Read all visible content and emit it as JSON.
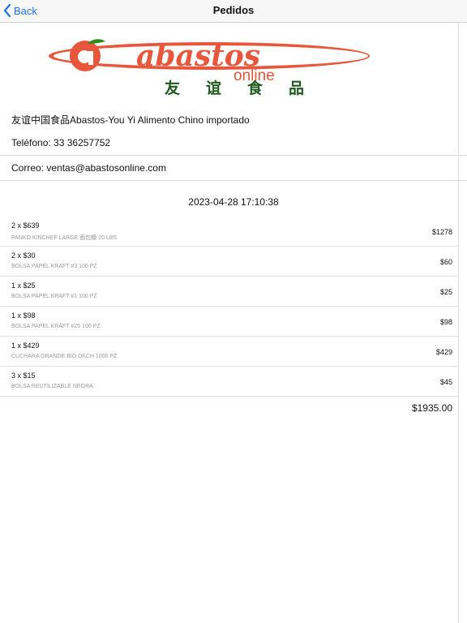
{
  "navbar": {
    "back_label": "Back",
    "title": "Pedidos"
  },
  "brand": {
    "logo_text": "abastos",
    "logo_sub": "online",
    "logo_chinese": "友谊食品",
    "logo_color": "#e8573c",
    "logo_dark_color": "#1f5a1f"
  },
  "store": {
    "name": "友谊中国食品Abastos-You Yi Alimento Chino importado",
    "phone": "Teléfono: 33 36257752",
    "email": "Correo: ventas@abastosonline.com"
  },
  "order": {
    "datetime": "2023-04-28 17:10:38",
    "items": [
      {
        "qty": "2 x $639",
        "desc": "PANKO KINCHEF LARGE 面包糠 20 LBS",
        "subtotal": "$1278"
      },
      {
        "qty": "2 x $30",
        "desc": "BOLSA PAPEL KRAFT #3 100 PZ",
        "subtotal": "$60"
      },
      {
        "qty": "1 x $25",
        "desc": "BOLSA PAPEL KRAFT #1 100 PZ",
        "subtotal": "$25"
      },
      {
        "qty": "1 x $98",
        "desc": "BOLSA PAPEL KRAFT #25 100 PZ",
        "subtotal": "$98"
      },
      {
        "qty": "1 x $429",
        "desc": "CUCHARA GRANDE BIO DKCH 1000 PZ",
        "subtotal": "$429"
      },
      {
        "qty": "3 x $15",
        "desc": "BOLSA REUTILIZABLE NEGRA",
        "subtotal": "$45"
      }
    ],
    "total": "$1935.00"
  },
  "icons": {
    "back": "chevron-left-icon",
    "logo": "abastos-logo"
  }
}
